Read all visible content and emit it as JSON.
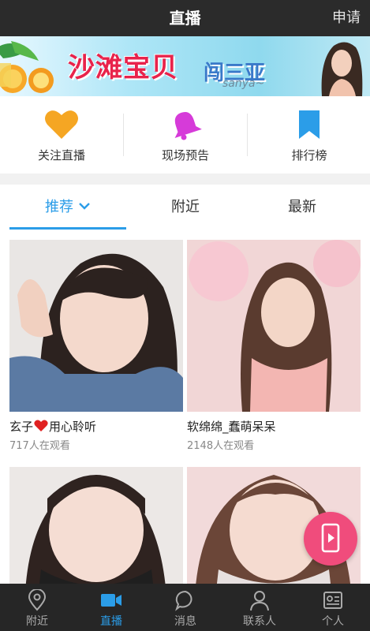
{
  "header": {
    "title": "直播",
    "apply_label": "申请"
  },
  "banner": {
    "title": "沙滩宝贝",
    "subtitle": "闯三亚",
    "en": "sanya~"
  },
  "quick_actions": [
    {
      "label": "关注直播",
      "icon": "heart-icon",
      "color": "#f5a623"
    },
    {
      "label": "现场预告",
      "icon": "bell-icon",
      "color": "#d63bd9"
    },
    {
      "label": "排行榜",
      "icon": "bookmark-icon",
      "color": "#2b9de8"
    }
  ],
  "tabs": [
    {
      "label": "推荐",
      "active": true
    },
    {
      "label": "附近",
      "active": false
    },
    {
      "label": "最新",
      "active": false
    }
  ],
  "streams": [
    {
      "name_prefix": "玄子",
      "name_suffix": "用心聆听",
      "viewers": "717人在观看"
    },
    {
      "name": "软绵绵_蠢萌呆呆",
      "viewers": "2148人在观看"
    },
    {
      "name": "",
      "viewers": ""
    },
    {
      "name": "",
      "viewers": ""
    }
  ],
  "bottom_nav": [
    {
      "label": "附近",
      "icon": "location-pin-icon",
      "active": false
    },
    {
      "label": "直播",
      "icon": "video-camera-icon",
      "active": true
    },
    {
      "label": "消息",
      "icon": "chat-bubble-icon",
      "active": false
    },
    {
      "label": "联系人",
      "icon": "person-icon",
      "active": false
    },
    {
      "label": "个人",
      "icon": "profile-card-icon",
      "active": false
    }
  ],
  "colors": {
    "accent": "#2b9de8",
    "fab": "#f04c7c",
    "topbar": "#2b2b2b",
    "bottombar": "#262626"
  }
}
